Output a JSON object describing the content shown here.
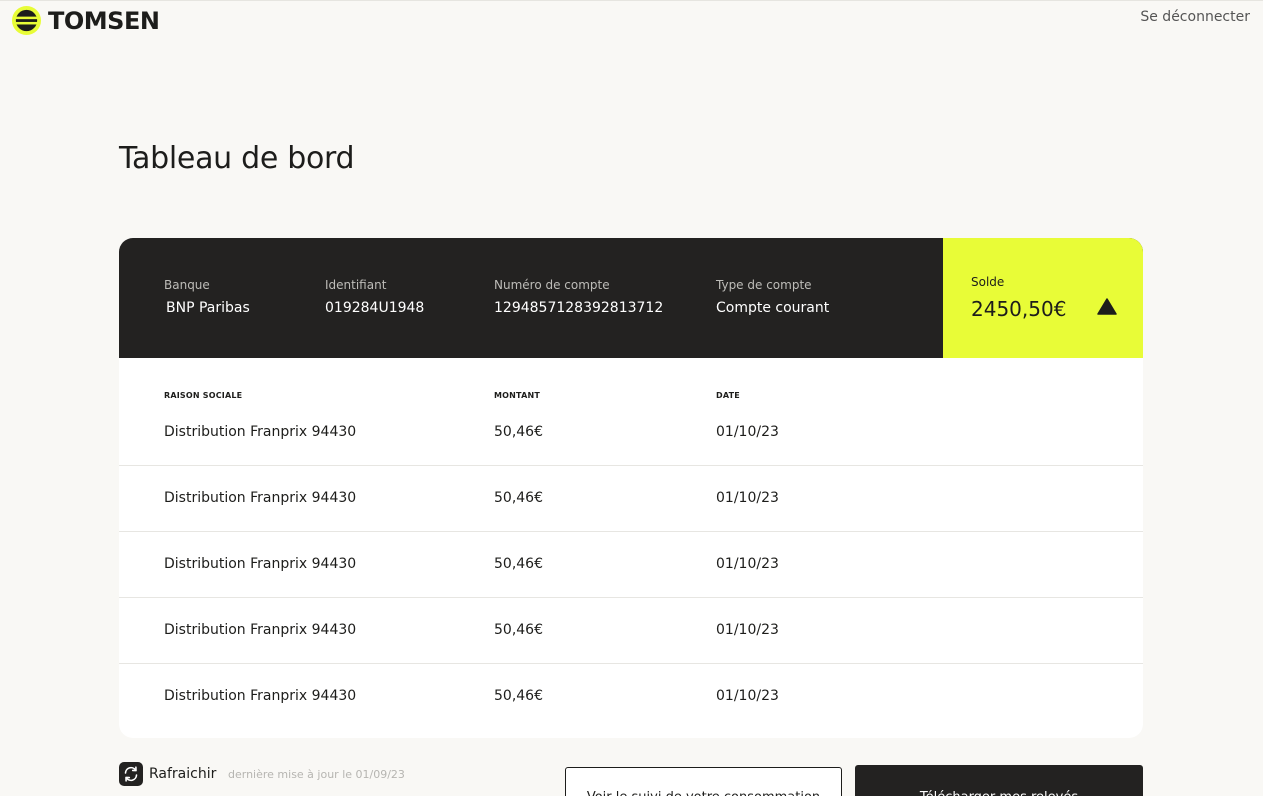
{
  "header": {
    "logo_text": "TOMSEN",
    "logout_label": "Se déconnecter"
  },
  "page": {
    "title": "Tableau de bord"
  },
  "account": {
    "bank_label": "Banque",
    "bank_value": "BNP Paribas",
    "id_label": "Identifiant",
    "id_value": "019284U1948",
    "number_label": "Numéro de compte",
    "number_value": "1294857128392813712",
    "type_label": "Type de compte",
    "type_value": "Compte courant",
    "balance_label": "Solde",
    "balance_value": "2450,50€",
    "balance_icon": "triangle-up-icon"
  },
  "table": {
    "headers": [
      "RAISON SOCIALE",
      "MONTANT",
      "DATE"
    ],
    "rows": [
      [
        "Distribution Franprix 94430",
        "50,46€",
        "01/10/23"
      ],
      [
        "Distribution Franprix 94430",
        "50,46€",
        "01/10/23"
      ],
      [
        "Distribution Franprix 94430",
        "50,46€",
        "01/10/23"
      ],
      [
        "Distribution Franprix 94430",
        "50,46€",
        "01/10/23"
      ],
      [
        "Distribution Franprix 94430",
        "50,46€",
        "01/10/23"
      ]
    ]
  },
  "footer": {
    "refresh_label": "Rafraichir",
    "last_update": "dernière mise à jour le 01/09/23",
    "consumption_button": "Voir le suivi de votre consommation",
    "download_button": "Télécharger mes relevés"
  },
  "colors": {
    "accent": "#e8fc37",
    "dark": "#232221",
    "background": "#f9f8f5"
  }
}
